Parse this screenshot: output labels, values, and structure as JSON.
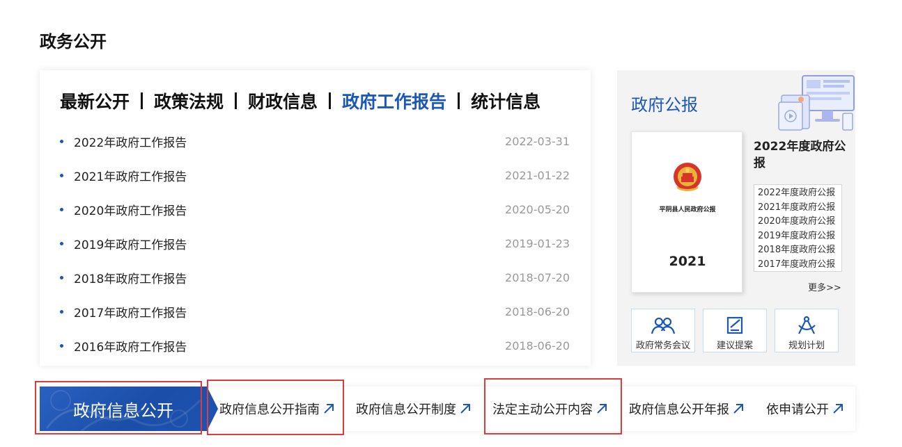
{
  "section_title": "政务公开",
  "tabs": [
    "最新公开",
    "政策法规",
    "财政信息",
    "政府工作报告",
    "统计信息"
  ],
  "active_tab": "政府工作报告",
  "news": [
    {
      "title": "2022年政府工作报告",
      "date": "2022-03-31"
    },
    {
      "title": "2021年政府工作报告",
      "date": "2021-01-22"
    },
    {
      "title": "2020年政府工作报告",
      "date": "2020-05-20"
    },
    {
      "title": "2019年政府工作报告",
      "date": "2019-01-23"
    },
    {
      "title": "2018年政府工作报告",
      "date": "2018-07-20"
    },
    {
      "title": "2017年政府工作报告",
      "date": "2018-06-20"
    },
    {
      "title": "2016年政府工作报告",
      "date": "2018-06-20"
    }
  ],
  "gazette": {
    "title": "政府公报",
    "cover_issuer": "平阴县人民政府公报",
    "cover_year": "2021",
    "current": "2022年度政府公报",
    "issues": [
      "2022年度政府公报",
      "2021年度政府公报",
      "2020年度政府公报",
      "2019年度政府公报",
      "2018年度政府公报",
      "2017年度政府公报"
    ],
    "more": "更多>>",
    "links": [
      {
        "label": "政府常务会议",
        "icon": "people-icon"
      },
      {
        "label": "建议提案",
        "icon": "edit-note-icon"
      },
      {
        "label": "规划计划",
        "icon": "compass-icon"
      }
    ]
  },
  "bottom_bar": {
    "main": "政府信息公开",
    "items": [
      "政府信息公开指南",
      "政府信息公开制度",
      "法定主动公开内容",
      "政府信息公开年报",
      "依申请公开"
    ]
  },
  "colors": {
    "accent": "#1a57b8",
    "highlight_box": "#e03b3b"
  }
}
